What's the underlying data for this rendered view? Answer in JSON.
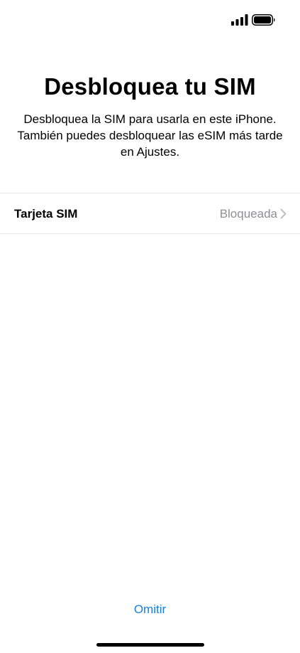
{
  "status_bar": {
    "signal_icon": "cellular-signal-icon",
    "battery_icon": "battery-full-icon"
  },
  "header": {
    "title": "Desbloquea tu SIM",
    "description_line1": "Desbloquea la SIM para usarla en este iPhone.",
    "description_line2": "También puedes desbloquear las eSIM más tarde",
    "description_line3": "en Ajustes."
  },
  "sim_row": {
    "label": "Tarjeta SIM",
    "value": "Bloqueada",
    "chevron_icon": "chevron-right-icon"
  },
  "footer": {
    "skip_label": "Omitir"
  },
  "colors": {
    "accent": "#1a7fd4",
    "secondary_text": "#8e8e93",
    "separator": "#e5e5ea"
  }
}
